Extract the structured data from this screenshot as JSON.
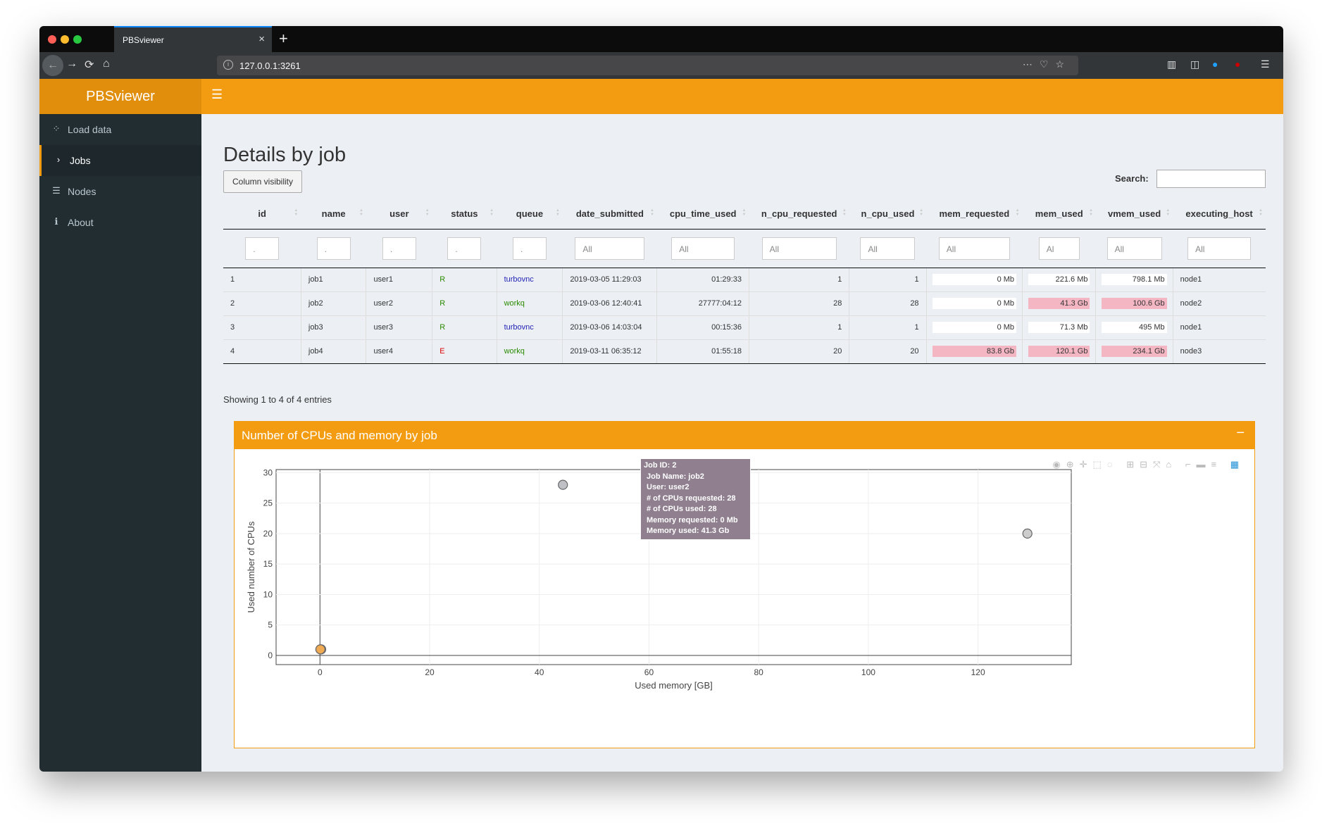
{
  "browser": {
    "tab_title": "PBSviewer",
    "tab_close": "×",
    "new_tab": "+",
    "url": "127.0.0.1:3261"
  },
  "app": {
    "logo": "PBSviewer",
    "accent": "#f39c12"
  },
  "sidebar": {
    "items": [
      {
        "label": "Load data",
        "icon": "spinner-icon"
      },
      {
        "label": "Jobs",
        "icon": "chevron-right-icon"
      },
      {
        "label": "Nodes",
        "icon": "table-icon"
      },
      {
        "label": "About",
        "icon": "info-icon"
      }
    ]
  },
  "main": {
    "title": "Details by job",
    "column_visibility": "Column visibility",
    "search_label": "Search:",
    "info": "Showing 1 to 4 of 4 entries"
  },
  "table": {
    "columns": [
      "id",
      "name",
      "user",
      "status",
      "queue",
      "date_submitted",
      "cpu_time_used",
      "n_cpu_requested",
      "n_cpu_used",
      "mem_requested",
      "mem_used",
      "vmem_used",
      "executing_host"
    ],
    "filters": [
      ".",
      ".",
      ".",
      ".",
      ".",
      "All",
      "All",
      "All",
      "All",
      "All",
      "Al",
      "All",
      "All"
    ],
    "rows": [
      [
        "1",
        "job1",
        "user1",
        "R",
        "turbovnc",
        "2019-03-05 11:29:03",
        "01:29:33",
        "1",
        "1",
        "0 Mb",
        "221.6 Mb",
        "798.1 Mb",
        "node1"
      ],
      [
        "2",
        "job2",
        "user2",
        "R",
        "workq",
        "2019-03-06 12:40:41",
        "27777:04:12",
        "28",
        "28",
        "0 Mb",
        "41.3 Gb",
        "100.6 Gb",
        "node2"
      ],
      [
        "3",
        "job3",
        "user3",
        "R",
        "turbovnc",
        "2019-03-06 14:03:04",
        "00:15:36",
        "1",
        "1",
        "0 Mb",
        "71.3 Mb",
        "495 Mb",
        "node1"
      ],
      [
        "4",
        "job4",
        "user4",
        "E",
        "workq",
        "2019-03-11 06:35:12",
        "01:55:18",
        "20",
        "20",
        "83.8 Gb",
        "120.1 Gb",
        "234.1 Gb",
        "node3"
      ]
    ]
  },
  "box": {
    "title": "Number of CPUs and memory by job",
    "collapse": "−"
  },
  "tooltip": {
    "lines": [
      "Job ID:  2",
      "Job Name:  job2",
      "User:  user2",
      "# of CPUs requested:  28",
      "# of CPUs used:  28",
      "Memory requested:  0 Mb",
      "Memory used:  41.3 Gb"
    ]
  },
  "chart_data": {
    "type": "scatter",
    "xlabel": "Used memory [GB]",
    "ylabel": "Used number of CPUs",
    "xlim": [
      -8,
      137
    ],
    "ylim": [
      -1.5,
      30.5
    ],
    "xticks": [
      0,
      20,
      40,
      60,
      80,
      100,
      120
    ],
    "yticks": [
      0,
      5,
      10,
      15,
      20,
      25,
      30
    ],
    "points": [
      {
        "x": 0.22,
        "y": 1,
        "color": "#f0a950"
      },
      {
        "x": 44.3,
        "y": 28,
        "color": "#b4b4bc"
      },
      {
        "x": 0.07,
        "y": 1,
        "color": "#f0a950"
      },
      {
        "x": 129,
        "y": 20,
        "color": "#c4c4c4"
      }
    ],
    "grid": true
  }
}
